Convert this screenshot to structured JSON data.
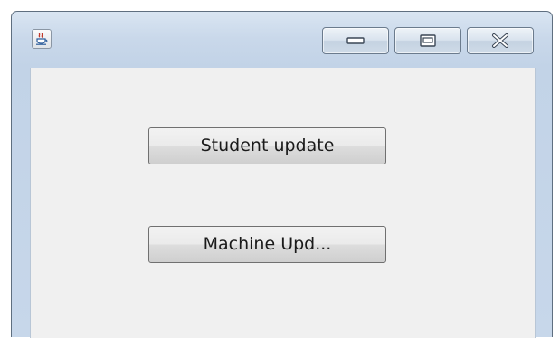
{
  "window": {
    "title_icon": "java-cup-icon",
    "caption_buttons": [
      {
        "name": "minimize",
        "icon": "minimize-icon"
      },
      {
        "name": "maximize",
        "icon": "maximize-icon"
      },
      {
        "name": "close",
        "icon": "close-icon"
      }
    ]
  },
  "content": {
    "student_update_label": "Student update",
    "machine_update_label": "Machine Upd..."
  },
  "colors": {
    "title_gradient_top": "#d9e5f2",
    "title_gradient_bottom": "#c2d3e7",
    "client_background": "#f0f0f0",
    "button_border": "#707070"
  }
}
